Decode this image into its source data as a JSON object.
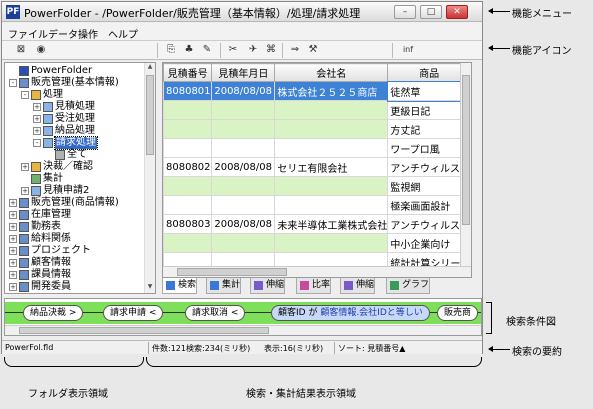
{
  "window": {
    "title": "PowerFolder - /PowerFolder/販売管理（基本情報）/処理/請求処理",
    "app_icon": "PF"
  },
  "menu": [
    "ファイル",
    "データ操作",
    "ヘルプ"
  ],
  "toolbar": {
    "icons": [
      "folder-icon",
      "eye-icon",
      "copy-icon",
      "pin-icon",
      "cut-icon",
      "scissors-icon",
      "plane-icon",
      "calc-icon",
      "arrow-icon",
      "tools-icon"
    ],
    "inf_label": "inf"
  },
  "tree": [
    {
      "label": "PowerFolder",
      "level": 0,
      "exp": "",
      "icon": "root"
    },
    {
      "label": "販売管理(基本情報)",
      "level": 0,
      "exp": "-",
      "icon": "db"
    },
    {
      "label": "処理",
      "level": 1,
      "exp": "-",
      "icon": "folder"
    },
    {
      "label": "見積処理",
      "level": 2,
      "exp": "+",
      "icon": "doc"
    },
    {
      "label": "受注処理",
      "level": 2,
      "exp": "+",
      "icon": "doc"
    },
    {
      "label": "納品処理",
      "level": 2,
      "exp": "+",
      "icon": "doc"
    },
    {
      "label": "請求処理",
      "level": 2,
      "exp": "-",
      "icon": "doc",
      "selected": true
    },
    {
      "label": "全て",
      "level": 3,
      "exp": "",
      "icon": "list"
    },
    {
      "label": "決裁／確認",
      "level": 1,
      "exp": "+",
      "icon": "folder"
    },
    {
      "label": "集計",
      "level": 1,
      "exp": "",
      "icon": "sum"
    },
    {
      "label": "見積申請2",
      "level": 1,
      "exp": "+",
      "icon": "doc"
    },
    {
      "label": "販売管理(商品情報)",
      "level": 0,
      "exp": "+",
      "icon": "db"
    },
    {
      "label": "在庫管理",
      "level": 0,
      "exp": "+",
      "icon": "db"
    },
    {
      "label": "勤務表",
      "level": 0,
      "exp": "+",
      "icon": "db"
    },
    {
      "label": "給料関係",
      "level": 0,
      "exp": "+",
      "icon": "db"
    },
    {
      "label": "プロジェクト",
      "level": 0,
      "exp": "+",
      "icon": "db"
    },
    {
      "label": "顧客情報",
      "level": 0,
      "exp": "+",
      "icon": "db"
    },
    {
      "label": "課員情報",
      "level": 0,
      "exp": "+",
      "icon": "db"
    },
    {
      "label": "開発委員",
      "level": 0,
      "exp": "+",
      "icon": "db"
    }
  ],
  "grid": {
    "columns": [
      "見積番号",
      "見積年月日",
      "会社名",
      "商品"
    ],
    "rows": [
      {
        "cells": [
          "8080801",
          "2008/08/08",
          "株式会社２５２５商店",
          "徒然草"
        ],
        "hl": true
      },
      {
        "cells": [
          "",
          "",
          "",
          "更級日記"
        ]
      },
      {
        "cells": [
          "",
          "",
          "",
          "方丈記"
        ]
      },
      {
        "cells": [
          "",
          "",
          "",
          "ワープロ風"
        ]
      },
      {
        "cells": [
          "8080802",
          "2008/08/08",
          "セリエ有限会社",
          "アンチウィルスＣ"
        ]
      },
      {
        "cells": [
          "",
          "",
          "",
          "監視網"
        ]
      },
      {
        "cells": [
          "",
          "",
          "",
          "極楽画面設計"
        ]
      },
      {
        "cells": [
          "8080803",
          "2008/08/08",
          "未来半導体工業株式会社",
          "アンチウィルスＢ"
        ]
      },
      {
        "cells": [
          "",
          "",
          "",
          "中小企業向け"
        ]
      },
      {
        "cells": [
          "",
          "",
          "",
          "統計計算シリーズ"
        ]
      }
    ]
  },
  "tabs": [
    "検索",
    "集計",
    "伸縮",
    "比率",
    "伸縮",
    "グラフ"
  ],
  "conditions": [
    {
      "text": "納品決裁 >"
    },
    {
      "text": "請求申請 <"
    },
    {
      "text": "請求取消 <"
    },
    {
      "text_a": "顧客ID が ",
      "text_b": "顧客情報.会社IDと等しい",
      "blue": true
    },
    {
      "text": "販売商"
    }
  ],
  "status": {
    "folder": "PowerFol.fld",
    "count": "件数:121",
    "search": "検索:234(ミリ秒)",
    "display": "表示:16(ミリ秒)",
    "sort": "ソート: 見積番号▲"
  },
  "annotations": {
    "menu": "機能メニュー",
    "icons": "機能アイコン",
    "cond": "検索条件図",
    "summary": "検索の要約",
    "folder_area": "フォルダ表示領域",
    "result_area": "検索・集計結果表示領域"
  }
}
